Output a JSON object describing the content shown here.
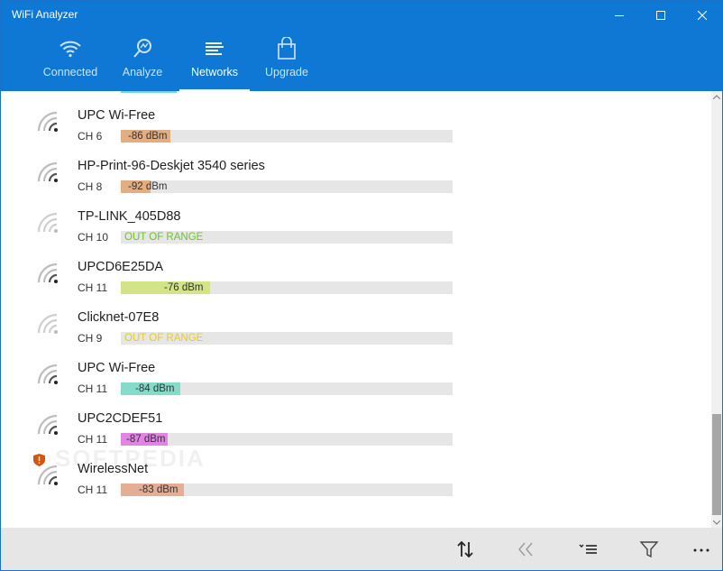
{
  "window": {
    "title": "WiFi Analyzer"
  },
  "tabs": [
    {
      "label": "Connected",
      "icon": "wifi-icon"
    },
    {
      "label": "Analyze",
      "icon": "magnifier-icon"
    },
    {
      "label": "Networks",
      "icon": "list-icon",
      "active": true
    },
    {
      "label": "Upgrade",
      "icon": "shopping-bag-icon"
    }
  ],
  "networks": [
    {
      "name": "UPC Wi-Free",
      "channel": "CH 6",
      "signal": "-86 dBm",
      "color": "#e3ad82",
      "strength": 0.15,
      "secured": false,
      "text_offset": 8
    },
    {
      "name": "HP-Print-96-Deskjet 3540 series",
      "channel": "CH 8",
      "signal": "-92 dBm",
      "color": "#e3ad82",
      "strength": 0.09,
      "secured": false,
      "text_offset": 8
    },
    {
      "name": "TP-LINK_405D88",
      "channel": "CH 10",
      "signal": "OUT OF RANGE",
      "color": "#6cc61e",
      "strength": 0,
      "secured": false,
      "out_of_range": true
    },
    {
      "name": "UPCD6E25DA",
      "channel": "CH 11",
      "signal": "-76 dBm",
      "color": "#d3e388",
      "strength": 0.27,
      "secured": false,
      "text_offset": 48
    },
    {
      "name": "Clicknet-07E8",
      "channel": "CH 9",
      "signal": "OUT OF RANGE",
      "color": "#e8cc16",
      "strength": 0,
      "secured": false,
      "out_of_range": true
    },
    {
      "name": "UPC Wi-Free",
      "channel": "CH 11",
      "signal": "-84 dBm",
      "color": "#84dbc9",
      "strength": 0.18,
      "secured": false,
      "text_offset": 16
    },
    {
      "name": "UPC2CDEF51",
      "channel": "CH 11",
      "signal": "-87 dBm",
      "color": "#e184e3",
      "strength": 0.14,
      "secured": false,
      "text_offset": 6
    },
    {
      "name": "WirelessNet",
      "channel": "CH 11",
      "signal": "-83 dBm",
      "color": "#e3ad96",
      "strength": 0.19,
      "secured": true,
      "text_offset": 20
    }
  ],
  "toolbar": {
    "sort": "sort-icon",
    "collapse": "collapse-icon",
    "list": "sort-list-icon",
    "filter": "filter-icon",
    "more": "more-icon"
  }
}
